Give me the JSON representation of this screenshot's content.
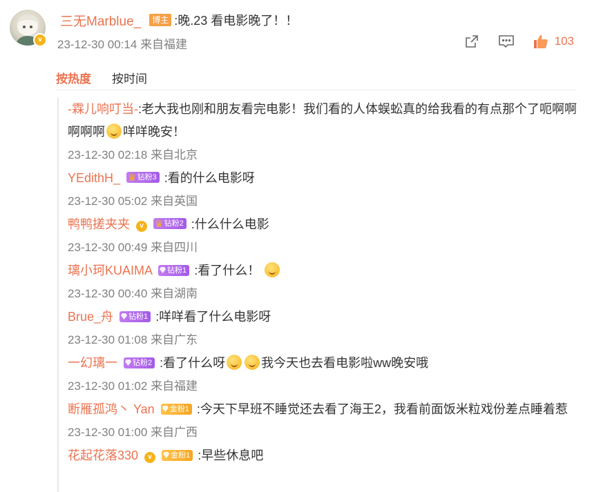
{
  "post": {
    "author": "三无Marblue_",
    "author_tag": "博主",
    "text": ":晚.23 看电影晚了！！",
    "time": "23-12-30 00:14",
    "location": "来自福建",
    "like_count": "103"
  },
  "tabs": [
    {
      "label": "按热度",
      "active": true
    },
    {
      "label": "按时间",
      "active": false
    }
  ],
  "replies": [
    {
      "name": "-霖儿响叮当-",
      "text_before": ":老大我也刚和朋友看完电影！我们看的人体蜈蚣真的给我看的有点那个了呃啊啊啊啊啊",
      "text_after": "咩咩晚安！",
      "time": "23-12-30 02:18",
      "location": "来自北京"
    },
    {
      "name": "YEdithH_",
      "badge": "钻粉3",
      "text": ":看的什么电影呀",
      "time": "23-12-30 05:02",
      "location": "来自英国"
    },
    {
      "name": "鸭鸭搓夹夹",
      "badge": "钻粉2",
      "text": ":什么什么电影",
      "time": "23-12-30 00:49",
      "location": "来自四川"
    },
    {
      "name": "璃小珂KUAIMA",
      "badge": "钻粉1",
      "text": ":看了什么！",
      "time": "23-12-30 00:40",
      "location": "来自湖南"
    },
    {
      "name": "Brue_舟",
      "badge": "钻粉1",
      "text": ":咩咩看了什么电影呀",
      "time": "23-12-30 01:08",
      "location": "来自广东"
    },
    {
      "name": "一幻璃一",
      "badge": "钻粉2",
      "text_before": ":看了什么呀",
      "text_after": "我今天也去看电影啦ww晚安哦",
      "time": "23-12-30 01:02",
      "location": "来自福建"
    },
    {
      "name": "断雁孤鸿丶 Yan",
      "badge": "金粉1",
      "text": ":今天下早班不睡觉还去看了海王2，我看前面饭米粒戏份差点睡着惹",
      "time": "23-12-30 01:00",
      "location": "来自广西"
    },
    {
      "name": "花起花落330",
      "badge": "金粉1",
      "text": ":早些休息吧"
    }
  ],
  "colors": {
    "accent": "#eb7350",
    "meta": "#808080"
  }
}
